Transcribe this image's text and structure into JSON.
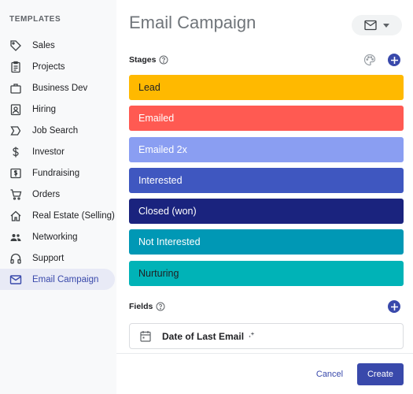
{
  "sidebar": {
    "heading": "TEMPLATES",
    "items": [
      {
        "label": "Sales",
        "icon": "tag-icon"
      },
      {
        "label": "Projects",
        "icon": "clipboard-icon"
      },
      {
        "label": "Business Dev",
        "icon": "briefcase-icon"
      },
      {
        "label": "Hiring",
        "icon": "badge-icon"
      },
      {
        "label": "Job Search",
        "icon": "chevron-tag-icon"
      },
      {
        "label": "Investor",
        "icon": "dollar-icon"
      },
      {
        "label": "Fundraising",
        "icon": "money-icon"
      },
      {
        "label": "Orders",
        "icon": "cart-icon"
      },
      {
        "label": "Real Estate (Selling)",
        "icon": "home-icon"
      },
      {
        "label": "Networking",
        "icon": "people-icon"
      },
      {
        "label": "Support",
        "icon": "headset-icon"
      },
      {
        "label": "Email Campaign",
        "icon": "mail-icon",
        "active": true
      }
    ]
  },
  "main": {
    "title": "Email Campaign",
    "type_dropdown": {
      "icon": "mail-icon"
    },
    "stages_label": "Stages",
    "stages": [
      {
        "label": "Lead",
        "color": "#ffb900",
        "text_color": "#202124"
      },
      {
        "label": "Emailed",
        "color": "#ff5a52",
        "text_color": "#ffffff"
      },
      {
        "label": "Emailed 2x",
        "color": "#8a9ef2",
        "text_color": "#ffffff"
      },
      {
        "label": "Interested",
        "color": "#3f57c0",
        "text_color": "#ffffff"
      },
      {
        "label": "Closed (won)",
        "color": "#1a237e",
        "text_color": "#ffffff"
      },
      {
        "label": "Not Interested",
        "color": "#0098b5",
        "text_color": "#ffffff"
      },
      {
        "label": "Nurturing",
        "color": "#00b3b7",
        "text_color": "#202124"
      }
    ],
    "fields_label": "Fields",
    "fields": [
      {
        "label": "Date of Last Email",
        "icon": "calendar-icon"
      }
    ]
  },
  "footer": {
    "cancel_label": "Cancel",
    "create_label": "Create"
  },
  "colors": {
    "accent": "#3949ab",
    "sidebar_bg": "#f8f9fa",
    "active_bg": "#e8eaf6"
  }
}
